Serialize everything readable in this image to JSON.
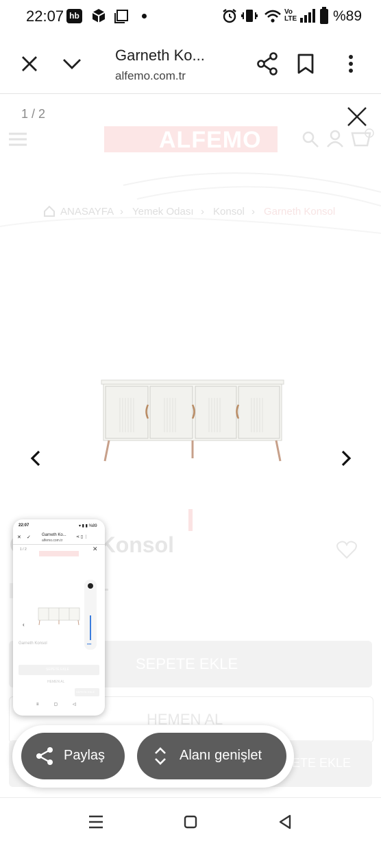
{
  "status_bar": {
    "time": "22:07",
    "battery_text": "%89",
    "icons": [
      "hb-icon",
      "box-icon",
      "square-icon",
      "dot-icon",
      "alarm-icon",
      "vibrate-icon",
      "wifi-icon",
      "volte-icon",
      "signal-icon",
      "battery-icon"
    ]
  },
  "tab_header": {
    "title": "Garneth Ko...",
    "url": "alfemo.com.tr"
  },
  "page": {
    "logo": "ALFEMO",
    "breadcrumb": [
      "ANASAYFA",
      "Yemek Odası",
      "Konsol",
      "Garneth Konsol"
    ],
    "product_title": "Garneth Konsol",
    "add_to_cart": "SEPETE EKLE",
    "buy_now": "HEMEN AL",
    "add_to_cart_2": "SEPETE EKLE"
  },
  "viewer": {
    "counter": "1 / 2"
  },
  "thumbnail": {
    "time": "22:07",
    "title": "Garneth Ko...",
    "url": "alfemo.com.tr",
    "counter": "1 / 2",
    "product": "Garneth Konsol",
    "button": "SEPETE EKLE",
    "button_2": "HEMEN AL",
    "button_3": "SEPETE EKLE"
  },
  "actions": {
    "share": "Paylaş",
    "expand": "Alanı genişlet"
  },
  "colors": {
    "pill": "#5c5c5c",
    "brand": "#e30613"
  }
}
